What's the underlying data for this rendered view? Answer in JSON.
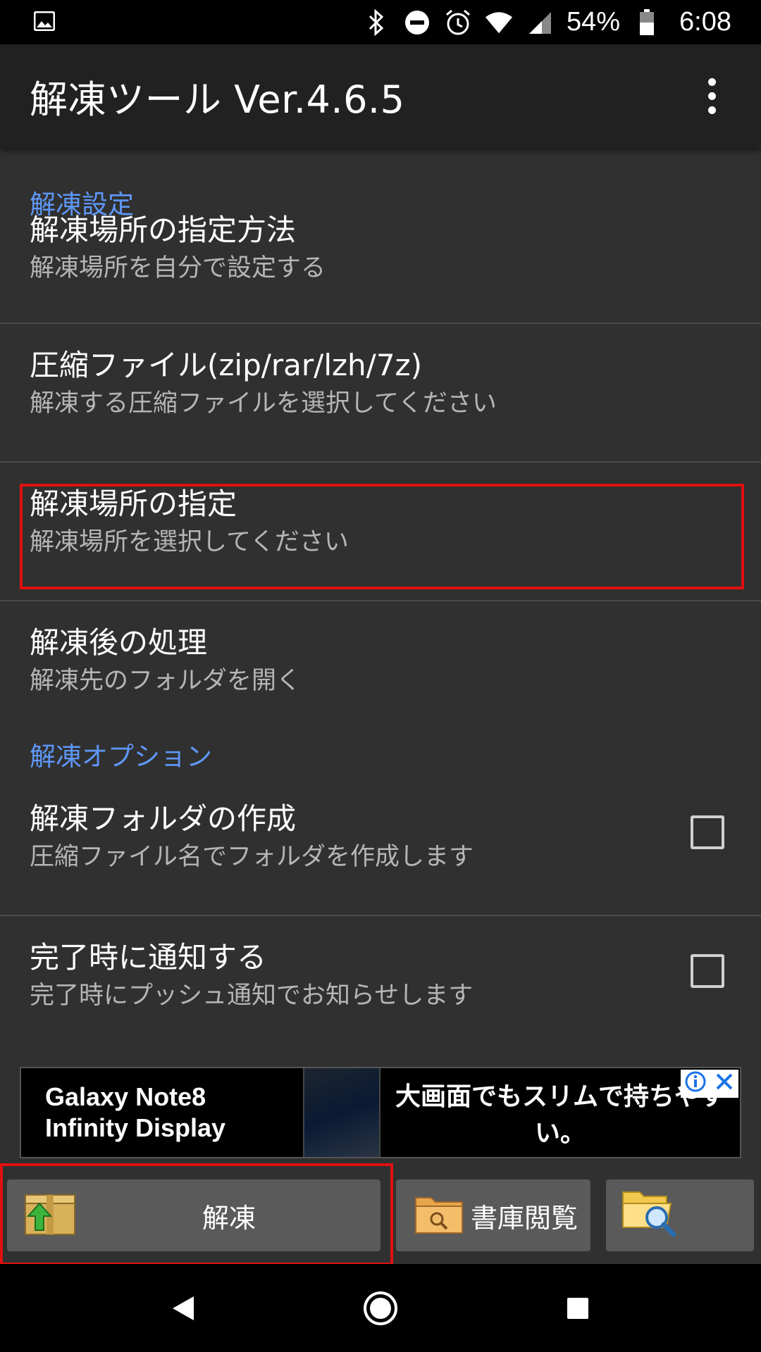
{
  "status_bar": {
    "battery_percent": "54%",
    "time": "6:08",
    "icons": [
      "image-icon",
      "bluetooth-icon",
      "do-not-disturb-icon",
      "alarm-icon",
      "wifi-icon",
      "signal-icon",
      "battery-icon"
    ]
  },
  "app_bar": {
    "title": "解凍ツール Ver.4.6.5",
    "overflow_icon": "more-vert-icon"
  },
  "sections": {
    "extract_settings": {
      "header": "解凍設定",
      "items": [
        {
          "title": "解凍場所の指定方法",
          "summary": "解凍場所を自分で設定する"
        },
        {
          "title": "圧縮ファイル(zip/rar/lzh/7z)",
          "summary": "解凍する圧縮ファイルを選択してください"
        },
        {
          "title": "解凍場所の指定",
          "summary": "解凍場所を選択してください"
        },
        {
          "title": "解凍後の処理",
          "summary": "解凍先のフォルダを開く"
        }
      ]
    },
    "extract_options": {
      "header": "解凍オプション",
      "items": [
        {
          "title": "解凍フォルダの作成",
          "summary": "圧縮ファイル名でフォルダを作成します",
          "checked": false
        },
        {
          "title": "完了時に通知する",
          "summary": "完了時にプッシュ通知でお知らせします",
          "checked": false
        }
      ]
    }
  },
  "ad": {
    "line1": "Galaxy Note8",
    "line2": "Infinity Display",
    "tagline": "大画面でもスリムで持ちやすい。"
  },
  "actions": {
    "extract_label": "解凍",
    "library_label": "書庫閲覧"
  },
  "colors": {
    "accent": "#5e97f6",
    "highlight": "#e01010",
    "background": "#303030",
    "app_bar": "#212121"
  }
}
